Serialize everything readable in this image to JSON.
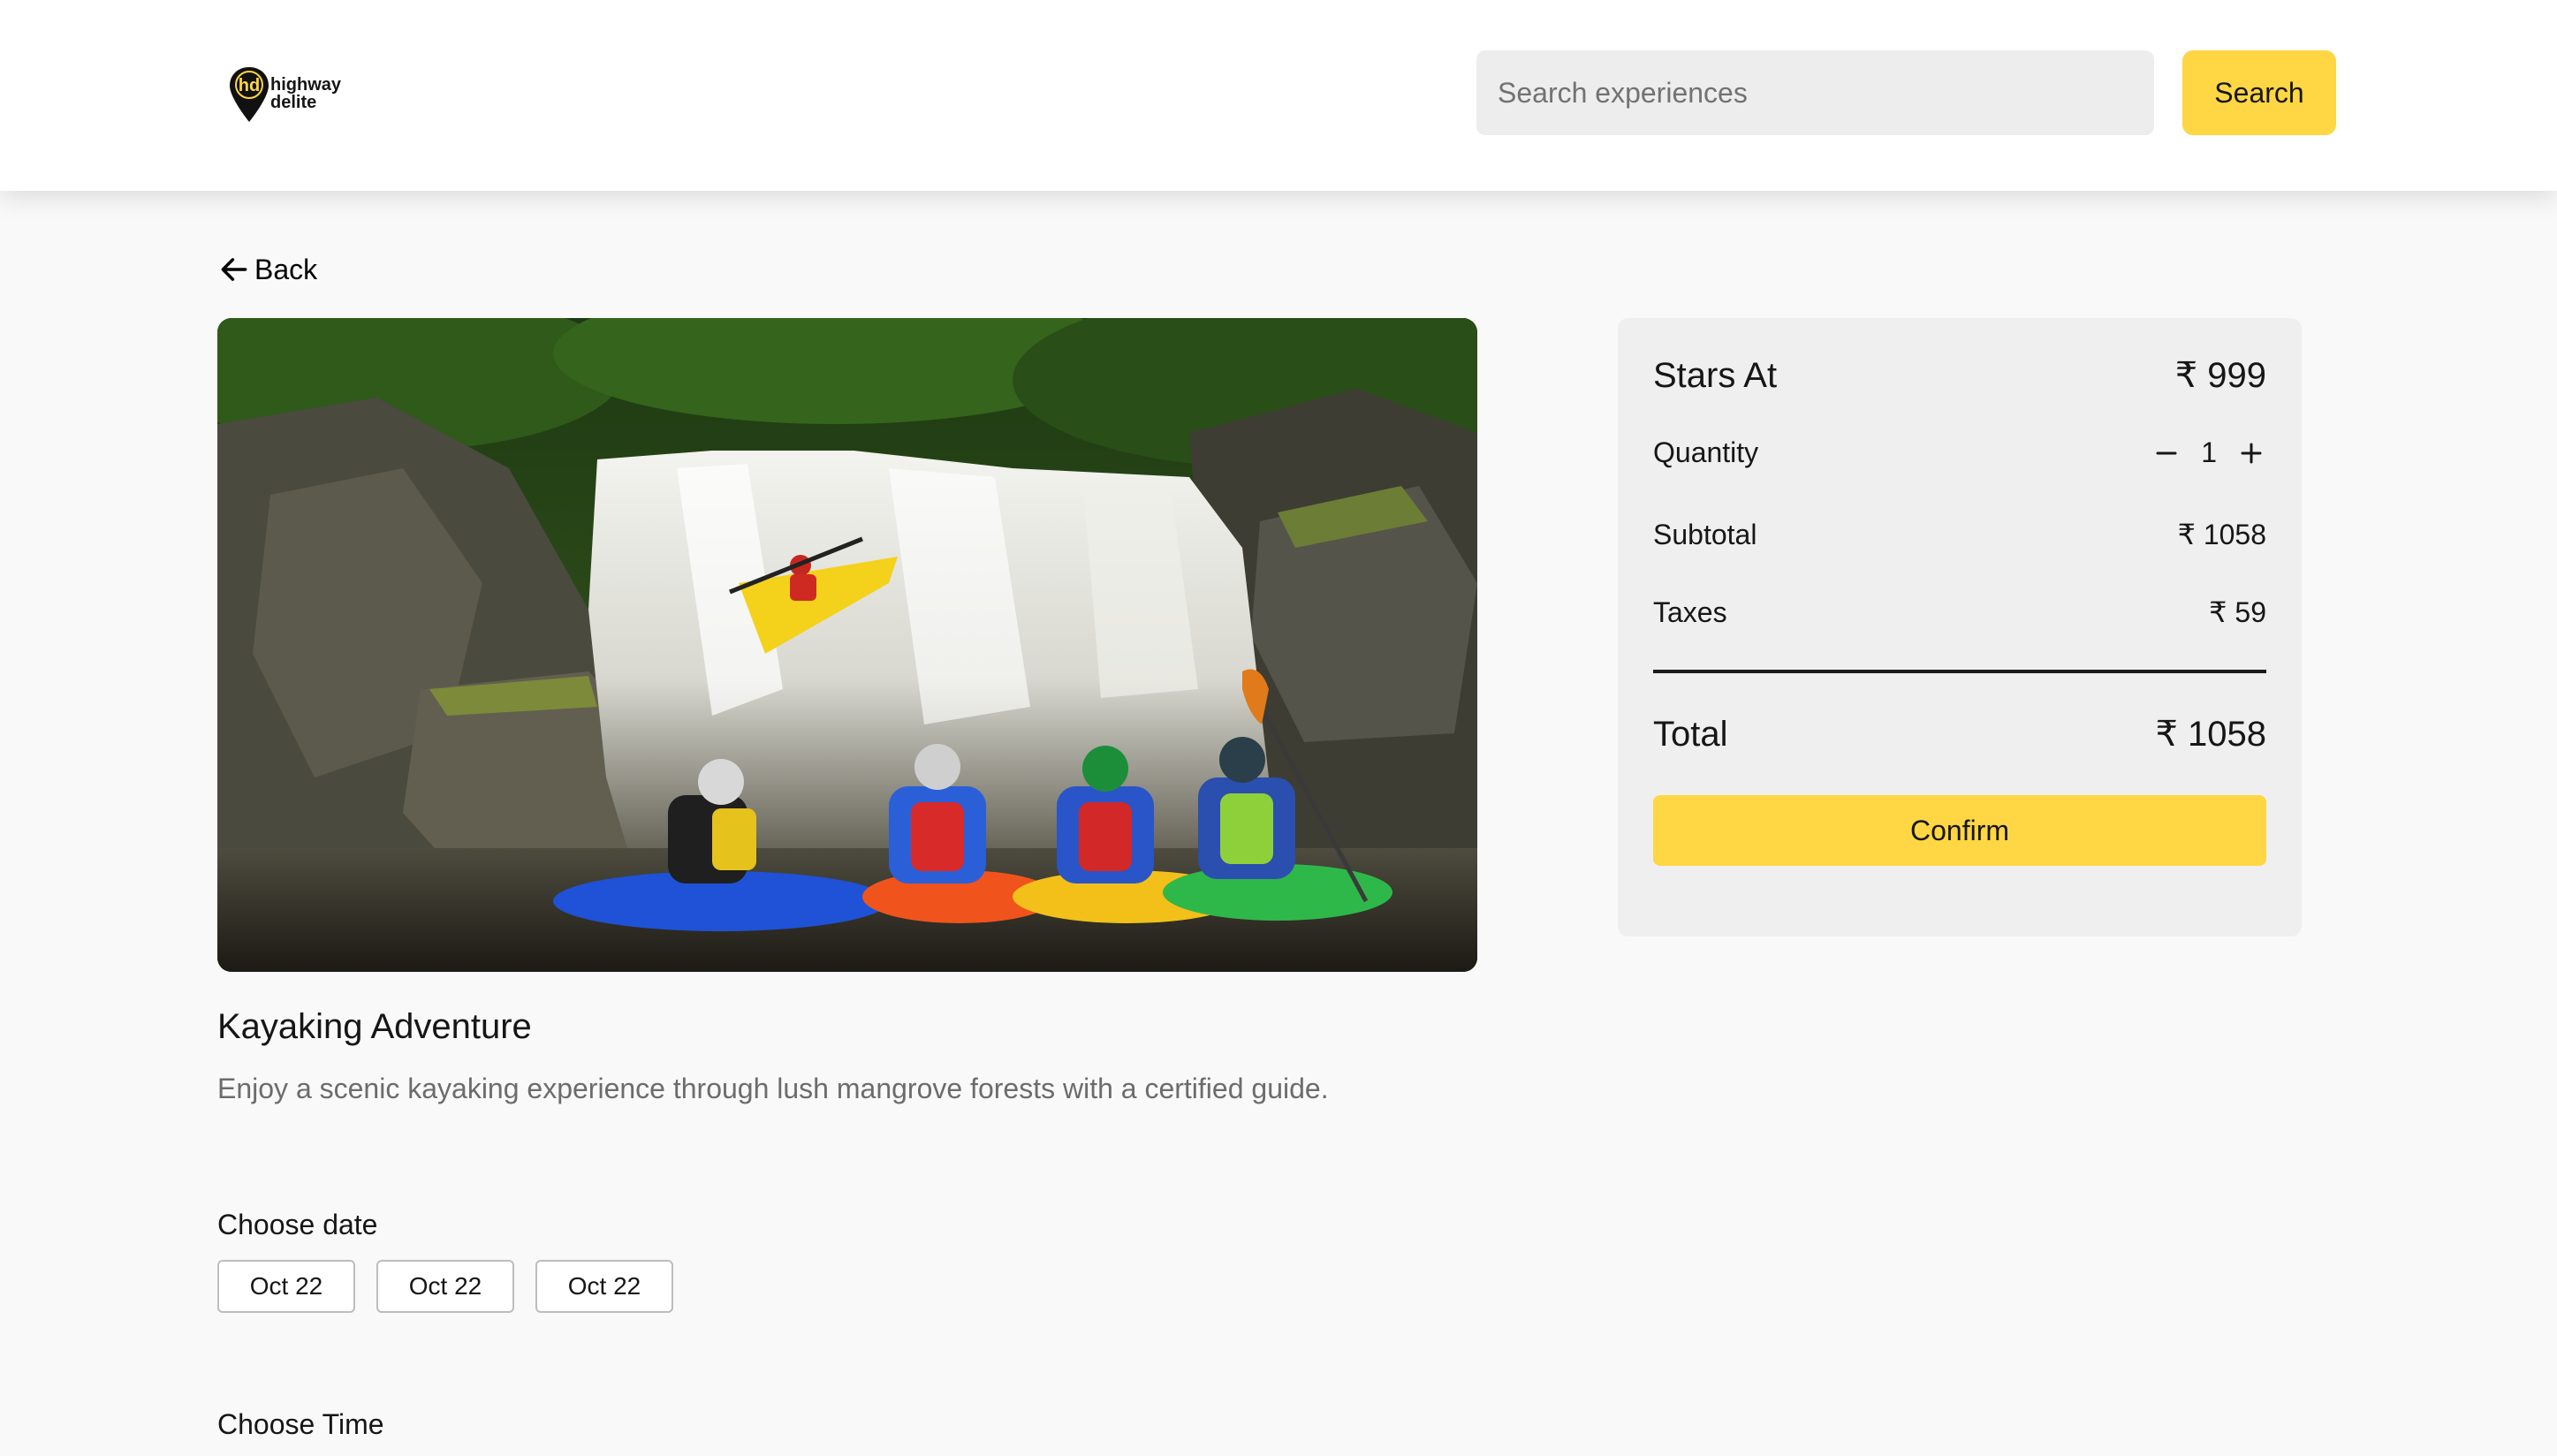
{
  "header": {
    "logo": {
      "line1": "highway",
      "line2": "delite",
      "mark": "hd"
    },
    "search": {
      "placeholder": "Search experiences",
      "value": ""
    },
    "search_button_label": "Search"
  },
  "back": {
    "label": "Back",
    "icon": "arrow-left-icon"
  },
  "experience": {
    "title": "Kayaking Adventure",
    "description": "Enjoy a scenic kayaking experience through lush mangrove forests with a certified guide.",
    "choose_date_label": "Choose date",
    "dates": [
      "Oct 22",
      "Oct 22",
      "Oct 22"
    ],
    "choose_time_label": "Choose Time"
  },
  "booking": {
    "starts_at_label": "Stars At",
    "starts_at_value": "₹ 999",
    "quantity_label": "Quantity",
    "quantity_value": "1",
    "subtotal_label": "Subtotal",
    "subtotal_value": "₹ 1058",
    "taxes_label": "Taxes",
    "taxes_value": "₹ 59",
    "total_label": "Total",
    "total_value": "₹ 1058",
    "confirm_label": "Confirm"
  },
  "colors": {
    "accent": "#ffd643",
    "card_bg": "#efefef",
    "input_bg": "#ededed",
    "page_bg": "#f9f9f9"
  }
}
